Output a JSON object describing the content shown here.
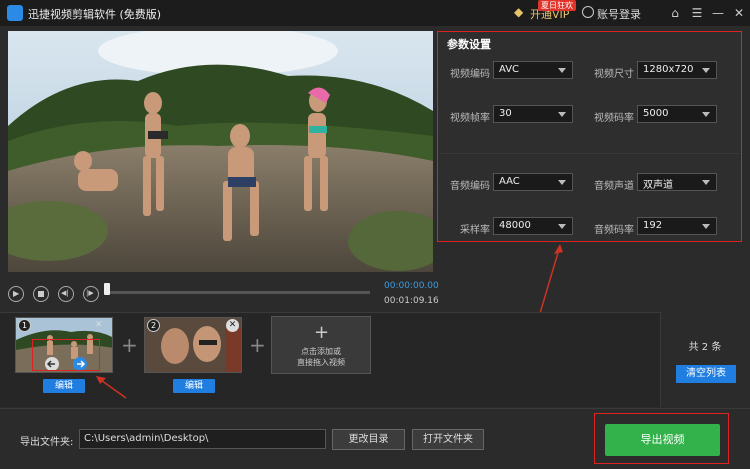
{
  "app": {
    "title": "迅捷视频剪辑软件 (免费版)",
    "vip_label": "开通VIP",
    "vip_badge": "夏日狂欢",
    "login_label": "账号登录"
  },
  "settings": {
    "title": "参数设置",
    "video_codec": {
      "label": "视频编码",
      "value": "AVC"
    },
    "video_size": {
      "label": "视频尺寸",
      "value": "1280x720"
    },
    "video_fps": {
      "label": "视频帧率",
      "value": "30"
    },
    "video_bitrate": {
      "label": "视频码率",
      "value": "5000"
    },
    "audio_codec": {
      "label": "音频编码",
      "value": "AAC"
    },
    "audio_channel": {
      "label": "音频声道",
      "value": "双声道"
    },
    "sample_rate": {
      "label": "采样率",
      "value": "48000"
    },
    "audio_bitrate": {
      "label": "音频码率",
      "value": "192"
    }
  },
  "player": {
    "current_time": "00:00:00.00",
    "total_time": "00:01:09.16",
    "progress": 0
  },
  "timeline": {
    "clips": [
      {
        "number": "1",
        "edit_label": "编辑"
      },
      {
        "number": "2",
        "edit_label": "编辑"
      }
    ],
    "add_text_line1": "点击添加或",
    "add_text_line2": "直接拖入视频",
    "count_label": "共 2 条",
    "clear_label": "清空列表"
  },
  "export": {
    "folder_label": "导出文件夹:",
    "path": "C:\\Users\\admin\\Desktop\\",
    "change_dir_label": "更改目录",
    "open_folder_label": "打开文件夹",
    "export_label": "导出视频"
  },
  "colors": {
    "accent": "#1f7ee0",
    "export_green": "#33b14a",
    "annotation_red": "#dd2222"
  }
}
